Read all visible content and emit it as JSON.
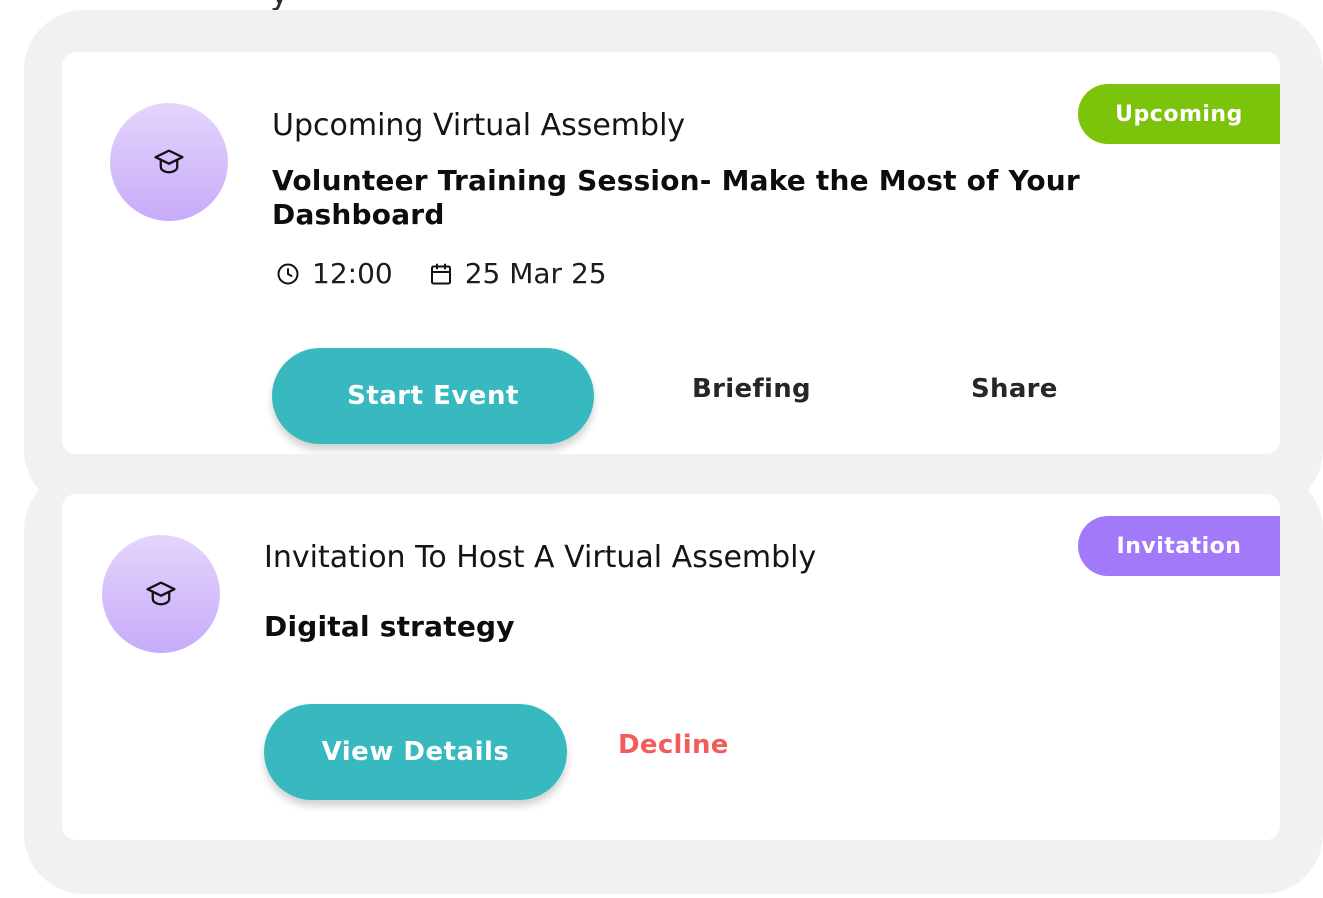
{
  "events": [
    {
      "kind": "Upcoming Virtual Assembly",
      "title": "Volunteer Training Session- Make the Most of Your Dashboard",
      "time": "12:00",
      "date": "25 Mar 25",
      "status": "Upcoming",
      "status_color": "#7cc30c",
      "avatar_icon": "graduation-cap-icon",
      "actions": {
        "primary": "Start Event",
        "secondary": "Briefing",
        "tertiary": "Share"
      }
    },
    {
      "kind": "Invitation To Host A Virtual Assembly",
      "title": "Digital strategy",
      "status": "Invitation",
      "status_color": "#a279f9",
      "avatar_icon": "graduation-cap-icon",
      "actions": {
        "primary": "View Details",
        "decline": "Decline",
        "decline_color": "#f45b5b"
      }
    }
  ],
  "accent_color": "#38b9bf"
}
